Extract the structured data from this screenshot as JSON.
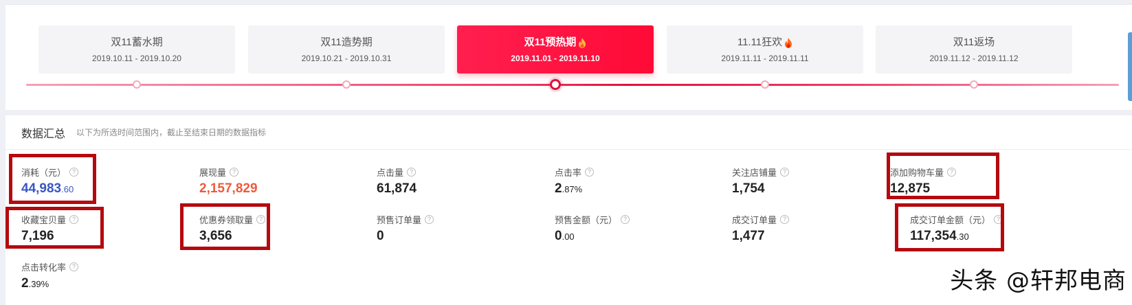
{
  "phases": [
    {
      "name": "双11蓄水期",
      "date": "2019.10.11 - 2019.10.20",
      "active": false,
      "fire": false
    },
    {
      "name": "双11造势期",
      "date": "2019.10.21 - 2019.10.31",
      "active": false,
      "fire": false
    },
    {
      "name": "双11预热期",
      "date": "2019.11.01 - 2019.11.10",
      "active": true,
      "fire": true
    },
    {
      "name": "11.11狂欢",
      "date": "2019.11.11 - 2019.11.11",
      "active": false,
      "fire": true
    },
    {
      "name": "双11返场",
      "date": "2019.11.12 - 2019.11.12",
      "active": false,
      "fire": false
    }
  ],
  "summary": {
    "title": "数据汇总",
    "subtitle": "以下为所选时间范围内，截止至结束日期的数据指标"
  },
  "metrics": [
    {
      "label": "消耗（元）",
      "int": "44,983",
      "dec": ".60",
      "color": "blue"
    },
    {
      "label": "展现量",
      "int": "2,157,829",
      "dec": "",
      "color": "red"
    },
    {
      "label": "点击量",
      "int": "61,874",
      "dec": "",
      "color": "default"
    },
    {
      "label": "点击率",
      "int": "2",
      "dec": ".87%",
      "color": "default"
    },
    {
      "label": "关注店铺量",
      "int": "1,754",
      "dec": "",
      "color": "default"
    },
    {
      "label": "添加购物车量",
      "int": "12,875",
      "dec": "",
      "color": "default"
    },
    {
      "label": "收藏宝贝量",
      "int": "7,196",
      "dec": "",
      "color": "default"
    },
    {
      "label": "优惠券领取量",
      "int": "3,656",
      "dec": "",
      "color": "default"
    },
    {
      "label": "预售订单量",
      "int": "0",
      "dec": "",
      "color": "default"
    },
    {
      "label": "预售金额（元）",
      "int": "0",
      "dec": ".00",
      "color": "default"
    },
    {
      "label": "成交订单量",
      "int": "1,477",
      "dec": "",
      "color": "default"
    },
    {
      "label": "成交订单金额（元）",
      "int": "117,354",
      "dec": ".30",
      "color": "default"
    },
    {
      "label": "点击转化率",
      "int": "2",
      "dec": ".39%",
      "color": "default"
    }
  ],
  "help_glyph": "?",
  "watermark": "头条 @轩邦电商",
  "colors": {
    "accent": "#ff1f4f",
    "highlight": "#b5090f",
    "blue_value": "#3a55c4",
    "red_value": "#ee5a3a"
  }
}
